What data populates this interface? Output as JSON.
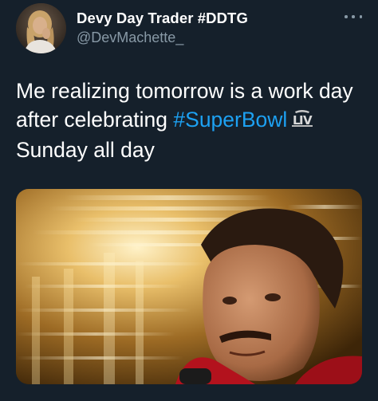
{
  "tweet": {
    "author": {
      "display_name": "Devy Day Trader #DDTG",
      "handle": "@DevMachette_"
    },
    "text": {
      "line1": "Me realizing tomorrow is a work day",
      "line2_prefix": "after celebrating ",
      "hashtag": "#SuperBowl",
      "line3": "Sunday all day"
    },
    "hashflag_icon": "super-bowl-lv-logo-icon",
    "more_icon": "more-options-icon",
    "colors": {
      "background": "#15202b",
      "text": "#ffffff",
      "secondary_text": "#8899a6",
      "link": "#1da1f2"
    }
  }
}
